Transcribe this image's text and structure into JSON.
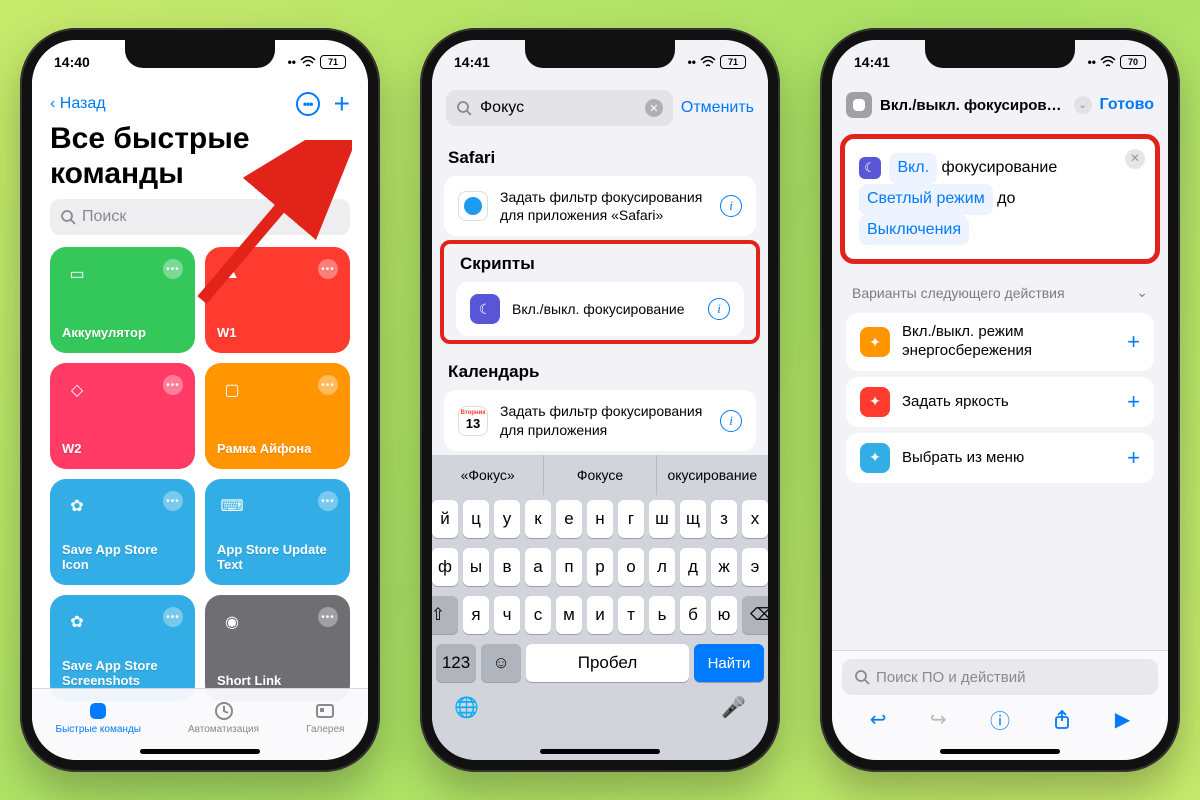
{
  "status": {
    "time1": "14:40",
    "time2": "14:41",
    "time3": "14:41",
    "battery1": "71",
    "battery2": "71",
    "battery3": "70"
  },
  "p1": {
    "back": "Назад",
    "title": "Все быстрые команды",
    "search_ph": "Поиск",
    "tiles": [
      {
        "label": "Аккумулятор",
        "color": "#34c759"
      },
      {
        "label": "W1",
        "color": "#ff3b30"
      },
      {
        "label": "W2",
        "color": "#ff3b66"
      },
      {
        "label": "Рамка Айфона",
        "color": "#ff9500"
      },
      {
        "label": "Save App Store Icon",
        "color": "#32ade6"
      },
      {
        "label": "App Store Update Text",
        "color": "#32ade6"
      },
      {
        "label": "Save App Store Screenshots",
        "color": "#32ade6"
      },
      {
        "label": "Short Link",
        "color": "#6e6e73"
      }
    ],
    "tabs": {
      "t1": "Быстрые команды",
      "t2": "Автоматизация",
      "t3": "Галерея"
    }
  },
  "p2": {
    "query": "Фокус",
    "cancel": "Отменить",
    "sec_safari": "Safari",
    "safari_row": "Задать фильтр фокусирования для приложения «Safari»",
    "sec_scripts": "Скрипты",
    "script_row": "Вкл./выкл. фокусирование",
    "sec_cal": "Календарь",
    "cal_day": "13",
    "cal_row": "Задать фильтр фокусирования для приложения",
    "suggest": [
      "«Фокус»",
      "Фокусе",
      "окусирование"
    ],
    "rows": [
      [
        "й",
        "ц",
        "у",
        "к",
        "е",
        "н",
        "г",
        "ш",
        "щ",
        "з",
        "х"
      ],
      [
        "ф",
        "ы",
        "в",
        "а",
        "п",
        "р",
        "о",
        "л",
        "д",
        "ж",
        "э"
      ],
      [
        "я",
        "ч",
        "с",
        "м",
        "и",
        "т",
        "ь",
        "б",
        "ю"
      ]
    ],
    "k123": "123",
    "space": "Пробел",
    "find": "Найти"
  },
  "p3": {
    "header": "Вкл./выкл. фокусирован…",
    "done": "Готово",
    "a_on": "Вкл.",
    "a_focus": "фокусирование",
    "a_light": "Светлый режим",
    "a_until": "до",
    "a_off": "Выключения",
    "next": "Варианты следующего действия",
    "sug": [
      {
        "label": "Вкл./выкл. режим энергосбережения",
        "color": "#ff9500"
      },
      {
        "label": "Задать яркость",
        "color": "#ff3b30"
      },
      {
        "label": "Выбрать из меню",
        "color": "#32ade6"
      }
    ],
    "search_ph": "Поиск ПО и действий"
  }
}
